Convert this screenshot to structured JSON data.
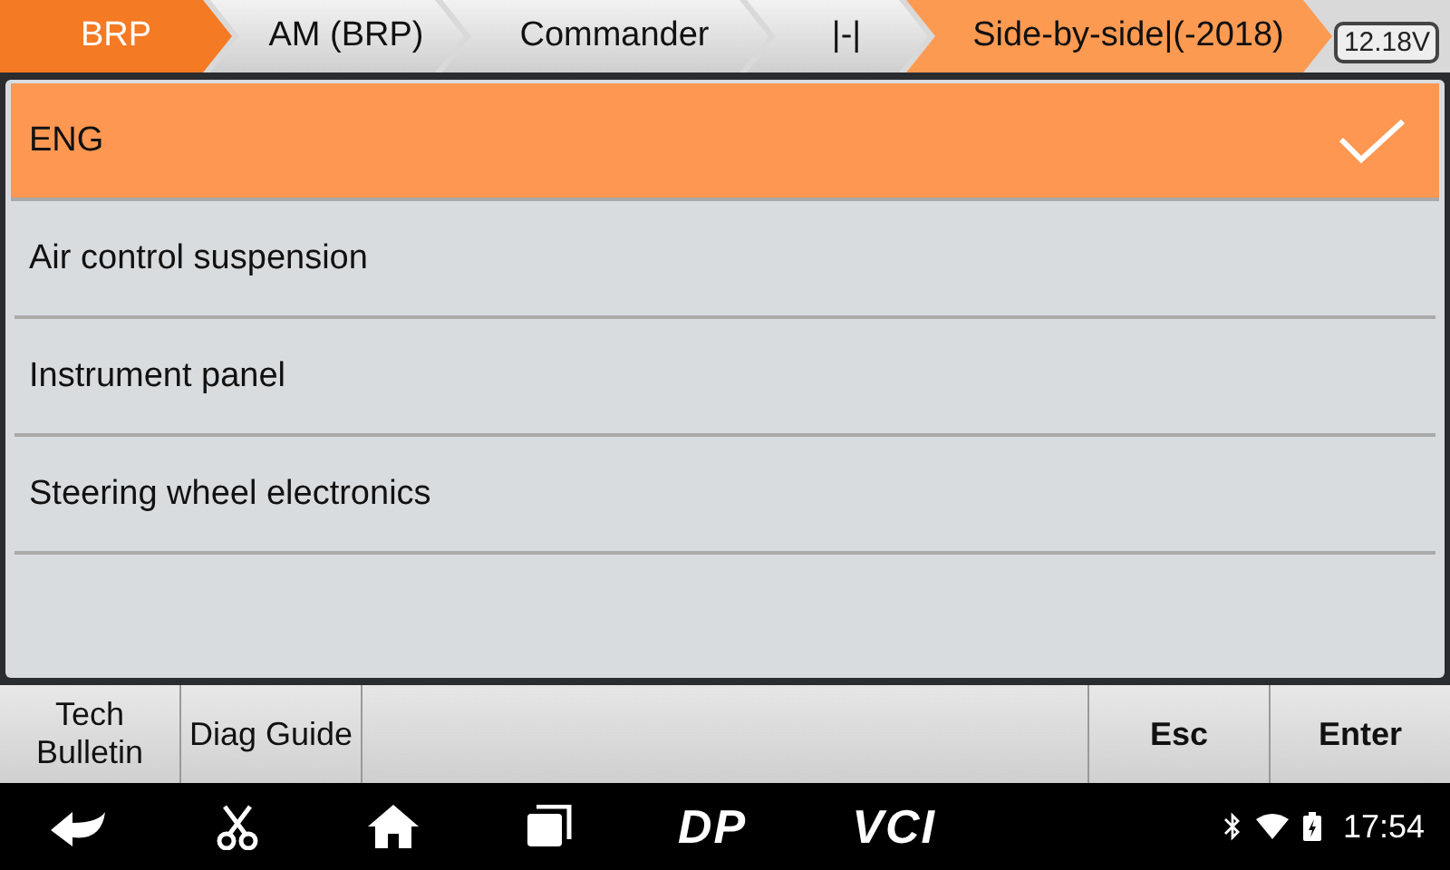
{
  "breadcrumb": [
    {
      "label": "BRP",
      "kind": "root"
    },
    {
      "label": "AM (BRP)",
      "kind": "path"
    },
    {
      "label": "Commander",
      "kind": "path"
    },
    {
      "label": "|-|",
      "kind": "path"
    },
    {
      "label": "Side-by-side|(-2018)",
      "kind": "current"
    }
  ],
  "battery": "12.18V",
  "systems": [
    {
      "label": "ENG",
      "selected": true
    },
    {
      "label": "Air control suspension",
      "selected": false
    },
    {
      "label": "Instrument panel",
      "selected": false
    },
    {
      "label": "Steering wheel electronics",
      "selected": false
    }
  ],
  "bottom_buttons": {
    "left": [
      "Tech Bulletin",
      "Diag Guide"
    ],
    "right": [
      "Esc",
      "Enter"
    ]
  },
  "nav_logos": [
    "DP",
    "VCI"
  ],
  "clock": "17:54"
}
